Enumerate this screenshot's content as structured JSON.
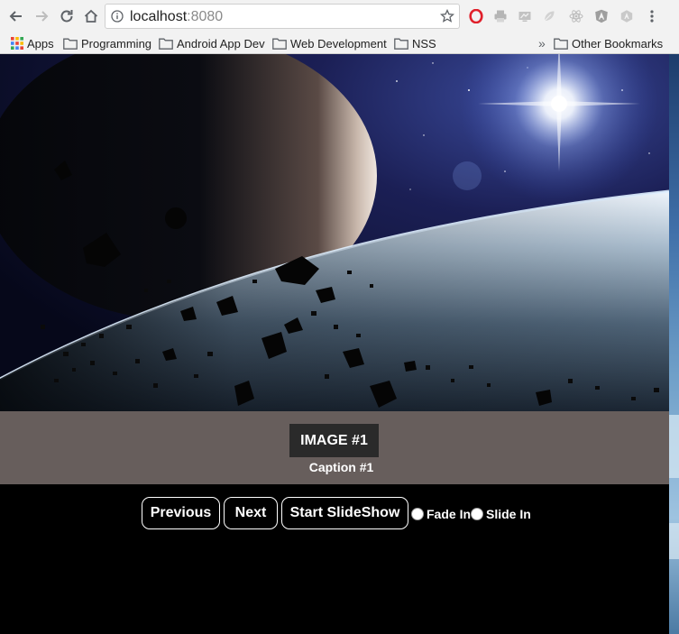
{
  "browser": {
    "url_host": "localhost",
    "url_port": ":8080",
    "bookmarks": [
      {
        "label": "Apps"
      },
      {
        "label": "Programming"
      },
      {
        "label": "Android App Dev"
      },
      {
        "label": "Web Development"
      },
      {
        "label": "NSS"
      }
    ],
    "overflow_glyph": "»",
    "other_bookmarks": "Other Bookmarks"
  },
  "slide": {
    "title": "IMAGE #1",
    "caption": "Caption #1"
  },
  "controls": {
    "previous": "Previous",
    "next": "Next",
    "start_slideshow": "Start SlideShow",
    "fade_in": "Fade In",
    "slide_in": "Slide In"
  },
  "colors": {
    "caption_background": "#675e5c",
    "title_background": "#2a2a2a",
    "page_background": "#000000",
    "button_border": "#ffffff"
  }
}
